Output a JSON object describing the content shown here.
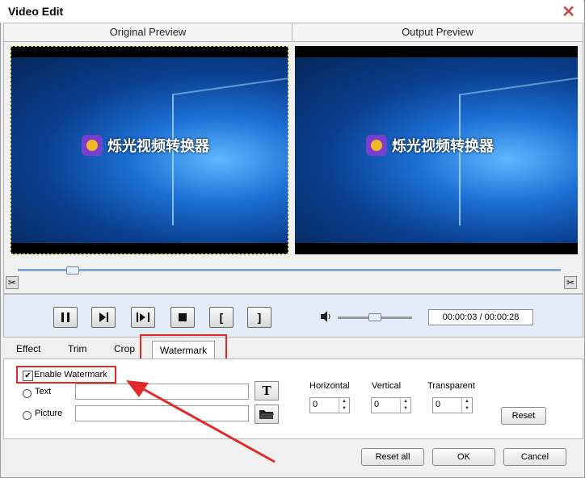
{
  "window": {
    "title": "Video Edit",
    "close": "✕"
  },
  "preview": {
    "original_label": "Original Preview",
    "output_label": "Output Preview",
    "watermark_text": "烁光视频转换器"
  },
  "playback": {
    "progress_fraction": 0.1,
    "time": "00:00:03 / 00:00:28",
    "volume_fraction": 0.45
  },
  "tabs": [
    {
      "label": "Effect"
    },
    {
      "label": "Trim"
    },
    {
      "label": "Crop"
    },
    {
      "label": "Watermark"
    }
  ],
  "watermark": {
    "enable_label": "Enable Watermark",
    "enable_checked": true,
    "text_label": "Text",
    "picture_label": "Picture",
    "text_value": "",
    "picture_value": "",
    "horizontal_label": "Horizontal",
    "horizontal_value": "0",
    "vertical_label": "Vertical",
    "vertical_value": "0",
    "transparent_label": "Transparent",
    "transparent_value": "0",
    "reset_label": "Reset"
  },
  "footer": {
    "reset_all_label": "Reset all",
    "ok_label": "OK",
    "cancel_label": "Cancel"
  },
  "colors": {
    "highlight": "#e02a2a",
    "accent_arrow": "#e02a2a"
  }
}
